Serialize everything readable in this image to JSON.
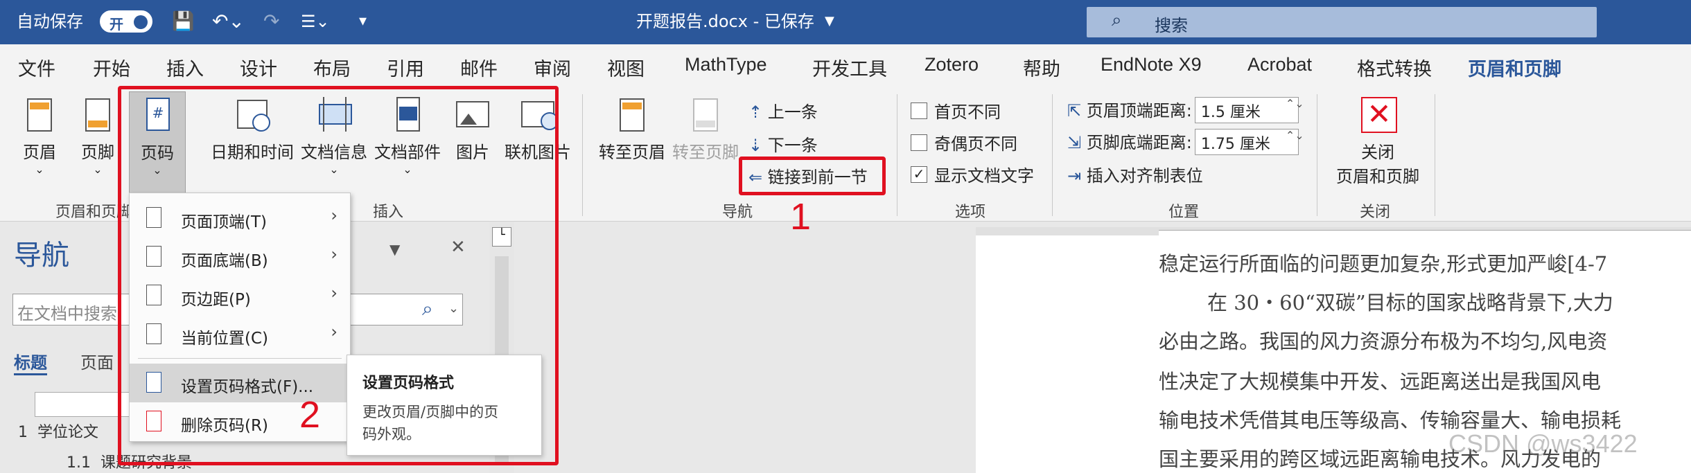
{
  "titlebar": {
    "autosave_label": "自动保存",
    "autosave_state": "开",
    "filename": "开题报告.docx - 已保存",
    "search_placeholder": "搜索"
  },
  "tabs": [
    "文件",
    "开始",
    "插入",
    "设计",
    "布局",
    "引用",
    "邮件",
    "审阅",
    "视图",
    "MathType",
    "开发工具",
    "Zotero",
    "帮助",
    "EndNote X9",
    "Acrobat",
    "格式转换",
    "页眉和页脚"
  ],
  "active_tab": "页眉和页脚",
  "ribbon": {
    "header_footer_group": {
      "header": "页眉",
      "footer": "页脚",
      "page_number": "页码",
      "group_label": "页眉和页脚"
    },
    "insert_group": {
      "date_time": "日期和时间",
      "doc_info": "文档信息",
      "doc_parts": "文档部件",
      "picture": "图片",
      "online_picture": "联机图片",
      "group_label": "插入"
    },
    "nav_group": {
      "goto_header": "转至页眉",
      "goto_footer": "转至页脚",
      "previous": "上一条",
      "next": "下一条",
      "link_previous": "链接到前一节",
      "group_label": "导航"
    },
    "options_group": {
      "different_first": "首页不同",
      "different_odd_even": "奇偶页不同",
      "show_doc_text": "显示文档文字",
      "group_label": "选项"
    },
    "position_group": {
      "header_top_label": "页眉顶端距离:",
      "header_top_value": "1.5 厘米",
      "footer_bottom_label": "页脚底端距离:",
      "footer_bottom_value": "1.75 厘米",
      "insert_align_tab": "插入对齐制表位",
      "group_label": "位置"
    },
    "close_group": {
      "close_label_1": "关闭",
      "close_label_2": "页眉和页脚",
      "group_label": "关闭"
    }
  },
  "annotations": {
    "marker1": "1",
    "marker2": "2",
    "color": "#e01020"
  },
  "page_number_menu": {
    "items": [
      {
        "label": "页面顶端(T)"
      },
      {
        "label": "页面底端(B)"
      },
      {
        "label": "页边距(P)"
      },
      {
        "label": "当前位置(C)"
      },
      {
        "label": "设置页码格式(F)..."
      },
      {
        "label": "删除页码(R)"
      }
    ]
  },
  "tooltip": {
    "title": "设置页码格式",
    "body_line1": "更改页眉/页脚中的页",
    "body_line2": "码外观。"
  },
  "navigation_pane": {
    "title": "导航",
    "search_placeholder": "在文档中搜索",
    "tab_headings": "标题",
    "tab_pages": "页面",
    "item1": "1  学位论文",
    "item2": "1.1  课题研究背景"
  },
  "document": {
    "lines": [
      "稳定运行所面临的问题更加复杂,形式更加严峻[4-7",
      "在 30・60“双碳”目标的国家战略背景下,大力",
      "必由之路。我国的风力资源分布极为不均匀,风电资",
      "性决定了大规模集中开发、远距离送出是我国风电",
      "输电技术凭借其电压等级高、传输容量大、输电损耗",
      "国主要采用的跨区域远距离输电技术。风力发电的"
    ]
  },
  "watermark": "CSDN @ws3422",
  "colors": {
    "brand": "#2b579a",
    "ribbon": "#f3f3f3"
  }
}
